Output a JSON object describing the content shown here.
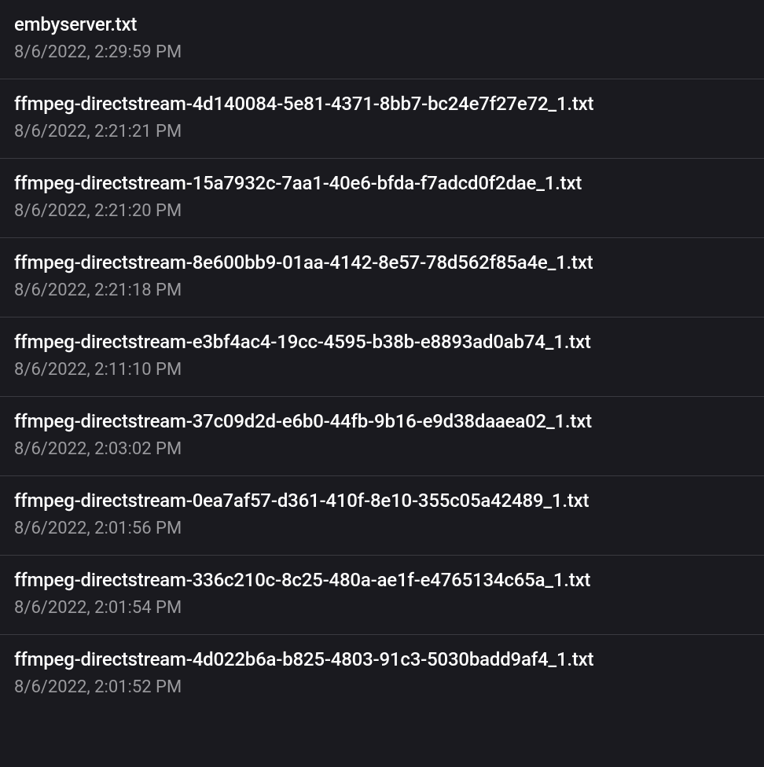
{
  "logs": [
    {
      "filename": "embyserver.txt",
      "timestamp": "8/6/2022, 2:29:59 PM"
    },
    {
      "filename": "ffmpeg-directstream-4d140084-5e81-4371-8bb7-bc24e7f27e72_1.txt",
      "timestamp": "8/6/2022, 2:21:21 PM"
    },
    {
      "filename": "ffmpeg-directstream-15a7932c-7aa1-40e6-bfda-f7adcd0f2dae_1.txt",
      "timestamp": "8/6/2022, 2:21:20 PM"
    },
    {
      "filename": "ffmpeg-directstream-8e600bb9-01aa-4142-8e57-78d562f85a4e_1.txt",
      "timestamp": "8/6/2022, 2:21:18 PM"
    },
    {
      "filename": "ffmpeg-directstream-e3bf4ac4-19cc-4595-b38b-e8893ad0ab74_1.txt",
      "timestamp": "8/6/2022, 2:11:10 PM"
    },
    {
      "filename": "ffmpeg-directstream-37c09d2d-e6b0-44fb-9b16-e9d38daaea02_1.txt",
      "timestamp": "8/6/2022, 2:03:02 PM"
    },
    {
      "filename": "ffmpeg-directstream-0ea7af57-d361-410f-8e10-355c05a42489_1.txt",
      "timestamp": "8/6/2022, 2:01:56 PM"
    },
    {
      "filename": "ffmpeg-directstream-336c210c-8c25-480a-ae1f-e4765134c65a_1.txt",
      "timestamp": "8/6/2022, 2:01:54 PM"
    },
    {
      "filename": "ffmpeg-directstream-4d022b6a-b825-4803-91c3-5030badd9af4_1.txt",
      "timestamp": "8/6/2022, 2:01:52 PM"
    }
  ]
}
